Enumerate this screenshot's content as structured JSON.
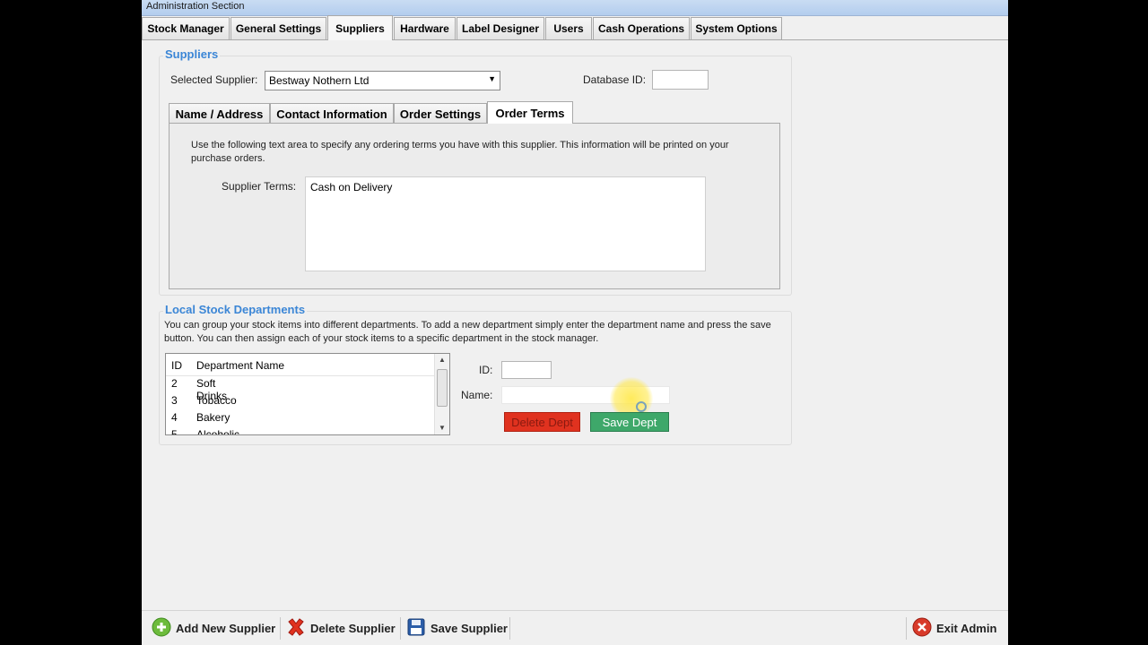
{
  "window": {
    "title": "Administration Section"
  },
  "main_tabs": [
    {
      "label": "Stock Manager"
    },
    {
      "label": "General Settings"
    },
    {
      "label": "Suppliers",
      "active": true
    },
    {
      "label": "Hardware"
    },
    {
      "label": "Label Designer"
    },
    {
      "label": "Users"
    },
    {
      "label": "Cash Operations"
    },
    {
      "label": "System Options"
    }
  ],
  "suppliers": {
    "legend": "Suppliers",
    "selected_label": "Selected Supplier:",
    "selected_value": "Bestway Nothern Ltd",
    "database_id_label": "Database ID:",
    "database_id_value": "",
    "sub_tabs": [
      {
        "label": "Name / Address"
      },
      {
        "label": "Contact Information"
      },
      {
        "label": "Order Settings"
      },
      {
        "label": "Order Terms",
        "active": true
      }
    ],
    "order_terms_description": "Use the following text area to specify any ordering terms you have with this supplier.  This information will be printed on your purchase orders.",
    "terms_label": "Supplier Terms:",
    "terms_value": "Cash on Delivery"
  },
  "departments": {
    "legend": "Local Stock Departments",
    "description": "You can group your stock items into different departments. To add a new department simply enter the department name and press the save button.  You can then assign each of your stock items to a specific department in the stock manager.",
    "columns": [
      "ID",
      "Department Name"
    ],
    "rows": [
      {
        "id": "2",
        "name": "Soft Drinks"
      },
      {
        "id": "3",
        "name": "Tobacco"
      },
      {
        "id": "4",
        "name": "Bakery"
      },
      {
        "id": "5",
        "name": "Alcoholic Drinks"
      }
    ],
    "id_label": "ID:",
    "id_value": "",
    "name_label": "Name:",
    "name_value": "",
    "delete_label": "Delete Dept",
    "save_label": "Save Dept"
  },
  "bottom_bar": {
    "add_label": "Add New Supplier",
    "delete_label": "Delete Supplier",
    "save_label": "Save Supplier",
    "exit_label": "Exit Admin"
  },
  "colors": {
    "accent": "#3b86d6",
    "delete_button": "#e0321f",
    "save_button": "#3ea86a",
    "cursor_highlight": "#ffe84a"
  }
}
